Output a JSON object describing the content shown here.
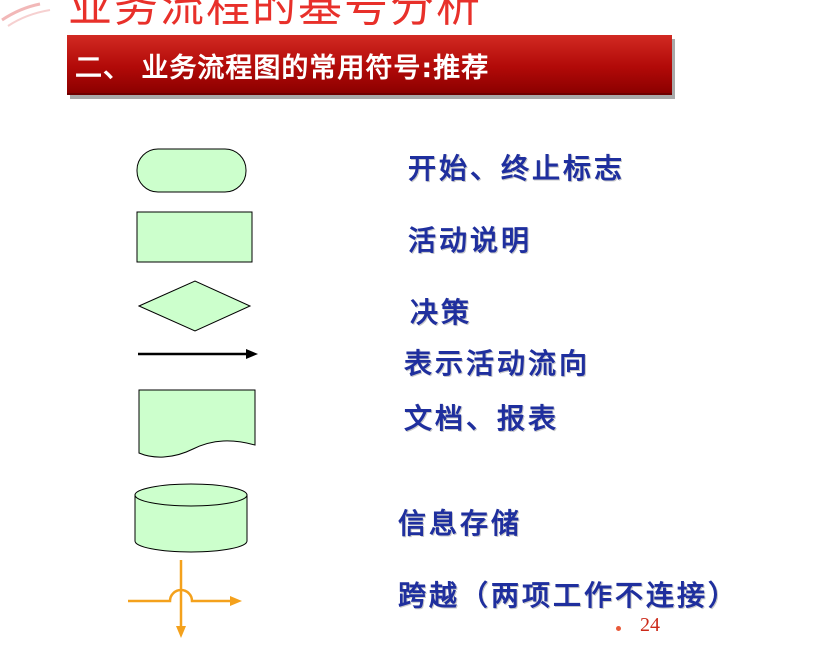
{
  "slide": {
    "top_title": "业务流程的基号分析",
    "banner_title": "二、 业务流程图的常用符号:推荐",
    "page_number": "24"
  },
  "symbols": [
    {
      "shape": "rounded-rectangle-icon",
      "label": "开始、终止标志"
    },
    {
      "shape": "rectangle-icon",
      "label": "活动说明"
    },
    {
      "shape": "diamond-icon",
      "label": "决策"
    },
    {
      "shape": "arrow-right-icon",
      "label": "表示活动流向"
    },
    {
      "shape": "document-icon",
      "label": "文档、报表"
    },
    {
      "shape": "cylinder-icon",
      "label": "信息存储"
    },
    {
      "shape": "crossover-icon",
      "label": "跨越（两项工作不连接）"
    }
  ],
  "colors": {
    "banner_red": "#b20a08",
    "symbol_fill": "#ccffcc",
    "label_blue": "#1f2f9e",
    "crossover_orange": "#f4a11c",
    "title_red": "#e8302a"
  }
}
